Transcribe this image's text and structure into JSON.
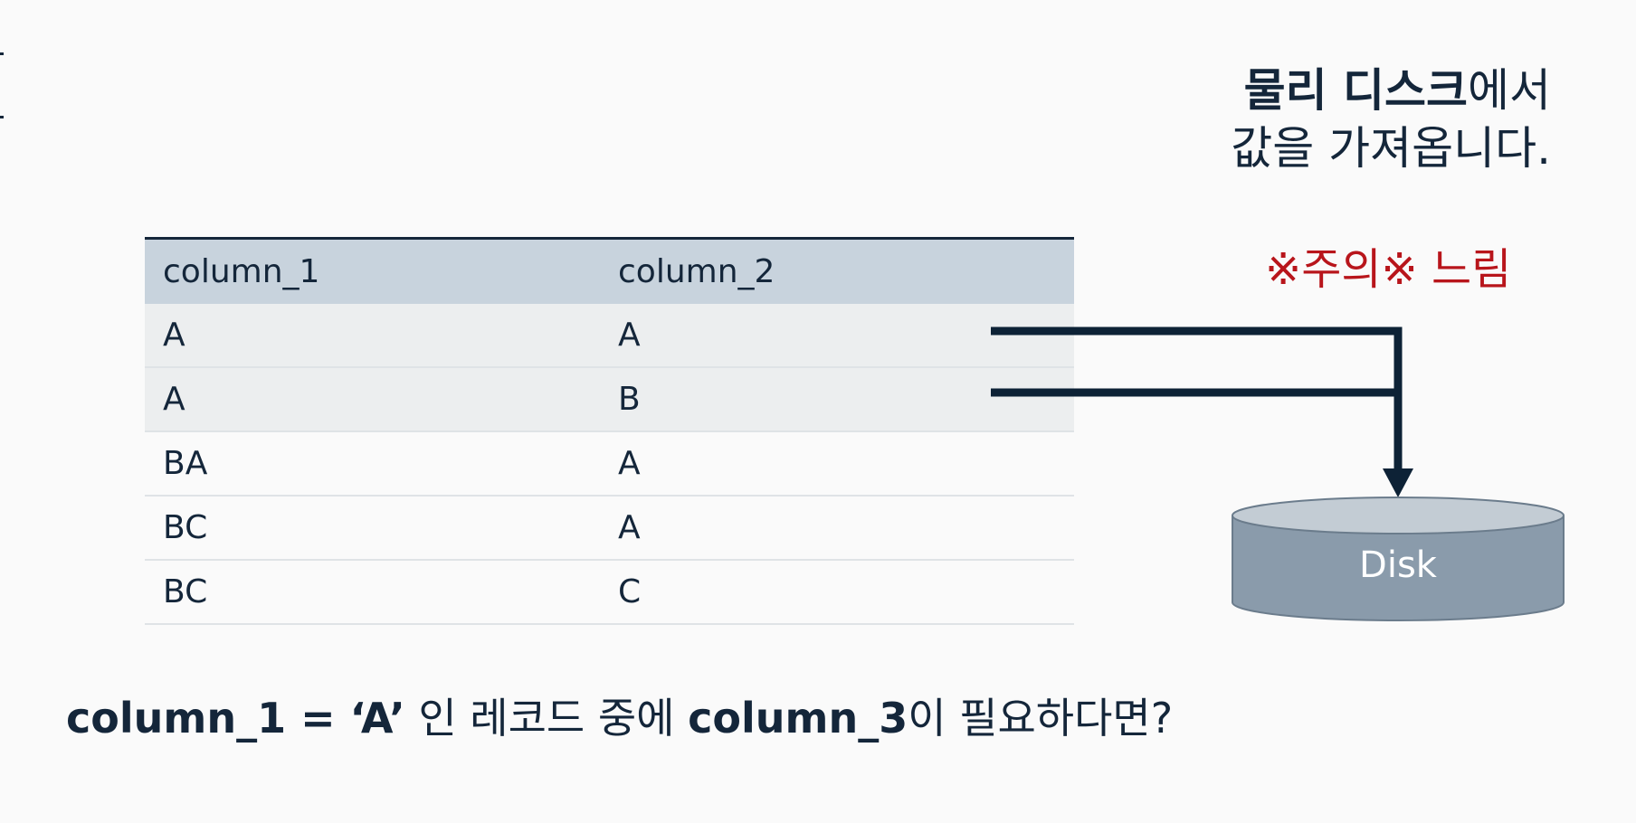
{
  "table": {
    "headers": [
      "column_1",
      "column_2"
    ],
    "rows": [
      [
        "A",
        "A"
      ],
      [
        "A",
        "B"
      ],
      [
        "BA",
        "A"
      ],
      [
        "BC",
        "A"
      ],
      [
        "BC",
        "C"
      ]
    ]
  },
  "note": {
    "line1_bold": "물리 디스크",
    "line1_rest": "에서",
    "line2": "값을 가져옵니다."
  },
  "warning": "※주의※ 느림",
  "disk": {
    "label": "Disk"
  },
  "question": {
    "part1": "column_1 = ‘A’",
    "part2": " 인 레코드 중에 ",
    "part3": "column_3",
    "part4": "이 필요하다면?"
  },
  "colors": {
    "text": "#14263a",
    "header_bg": "#c8d3dd",
    "highlight_bg": "#eceeef",
    "warning": "#b8151b",
    "disk_body": "#8a9bab",
    "disk_top": "#c3ccd4"
  }
}
